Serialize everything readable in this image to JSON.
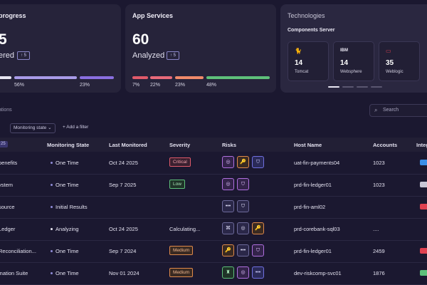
{
  "cards": {
    "progress": {
      "title": "progress",
      "value": "5",
      "sub": "ered",
      "delta": "↑ 5",
      "bars": [
        {
          "pct": "",
          "color": "#e8e6f2",
          "fraction": 0.1
        },
        {
          "pct": "56%",
          "color": "#a99be8",
          "fraction": 0.56
        },
        {
          "pct": "23%",
          "color": "#8a6fe0",
          "fraction": 0.23
        }
      ]
    },
    "app": {
      "title": "App Services",
      "value": "60",
      "sub": "Analyzed",
      "delta": "↑ 5",
      "bars": [
        {
          "pct": "7%",
          "color": "#e05a6a",
          "fraction": 0.07
        },
        {
          "pct": "22%",
          "color": "#e86a7a",
          "fraction": 0.22
        },
        {
          "pct": "23%",
          "color": "#f08a6a",
          "fraction": 0.23
        },
        {
          "pct": "48%",
          "color": "#5ec07a",
          "fraction": 0.48
        }
      ]
    },
    "tech": {
      "title": "Technologies",
      "subtitle": "Components Server",
      "components": [
        {
          "icon": "tomcat-icon",
          "glyph": "🐈",
          "value": "14",
          "name": "Tomcat"
        },
        {
          "icon": "ibm-icon",
          "glyph": "IBM",
          "value": "14",
          "name": "Websphere"
        },
        {
          "icon": "oracle-icon",
          "glyph": "▭",
          "value": "35",
          "name": "Weblogic"
        }
      ]
    }
  },
  "section": {
    "label": "ations",
    "search_placeholder": "Search",
    "filter_chip": "Monitoring state",
    "add_filter": "+ Add a filter"
  },
  "table": {
    "header_badge": "25",
    "columns": [
      "Monitoring State",
      "Last Monitored",
      "Severity",
      "Risks",
      "Host Name",
      "Accounts",
      "Integ"
    ],
    "rows": [
      {
        "name": "benefits",
        "state": "One Time",
        "last": "Oct 24 2025",
        "severity": "Critical",
        "sev_class": "sev-critical",
        "risks": [
          {
            "g": "◎",
            "c": "risk-purple"
          },
          {
            "g": "🔑",
            "c": "risk-orange"
          },
          {
            "g": "⛉",
            "c": "risk-blue"
          }
        ],
        "host": "uat-fin-payments04",
        "accounts": "1023",
        "integ_color": "#3a8ee8"
      },
      {
        "name": "ystem",
        "state": "One Time",
        "last": "Sep 7 2025",
        "severity": "Low",
        "sev_class": "sev-low",
        "risks": [
          {
            "g": "◎",
            "c": "risk-purple"
          },
          {
            "g": "⛉",
            "c": "risk-purple"
          }
        ],
        "host": "prd-fin-ledger01",
        "accounts": "1023",
        "integ_color": "#c8c6d6"
      },
      {
        "name": "source",
        "state": "Initial Results",
        "last": "",
        "severity": "",
        "sev_class": "",
        "risks": [
          {
            "g": "•••",
            "c": ""
          },
          {
            "g": "⛉",
            "c": ""
          }
        ],
        "host": "prd-fin-aml02",
        "accounts": "",
        "integ_color": "#e04050"
      },
      {
        "name": "Ledger",
        "state": "Analyzing",
        "last": "Oct 24 2025",
        "severity": "Calculating...",
        "sev_class": "",
        "risks": [
          {
            "g": "⌘",
            "c": ""
          },
          {
            "g": "◎",
            "c": ""
          },
          {
            "g": "🔑",
            "c": "risk-orange"
          }
        ],
        "host": "prd-corebank-sql03",
        "accounts": "....",
        "integ_color": ""
      },
      {
        "name": "Reconciliation...",
        "state": "One Time",
        "last": "Sep 7 2024",
        "severity": "Medium",
        "sev_class": "sev-medium",
        "risks": [
          {
            "g": "🔑",
            "c": "risk-orange"
          },
          {
            "g": "•••",
            "c": ""
          },
          {
            "g": "⛉",
            "c": "risk-purple"
          }
        ],
        "host": "prd-fin-ledger01",
        "accounts": "2459",
        "integ_color": "#e04050"
      },
      {
        "name": "ination Suite",
        "state": "One Time",
        "last": "Nov 01 2024",
        "severity": "Medium",
        "sev_class": "sev-medium",
        "risks": [
          {
            "g": "♜",
            "c": "risk-green"
          },
          {
            "g": "◎",
            "c": "risk-purple"
          },
          {
            "g": "•••",
            "c": "risk-blue"
          }
        ],
        "host": "dev-riskcomp-svc01",
        "accounts": "1876",
        "integ_color": "#5ec07a"
      }
    ]
  }
}
